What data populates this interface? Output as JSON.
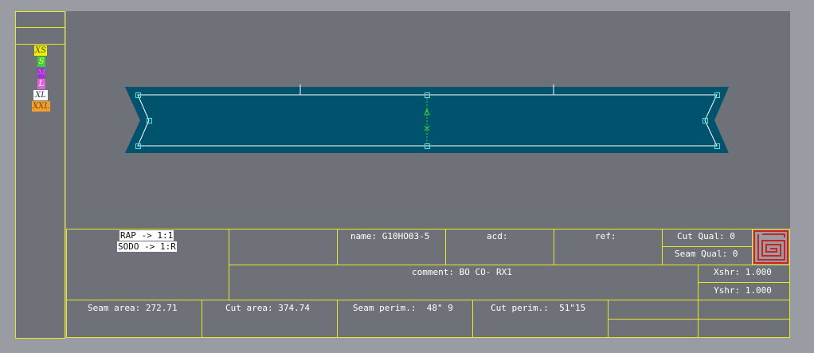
{
  "sizes": [
    {
      "label": "XS",
      "color": "#f0f000",
      "text": "#444444"
    },
    {
      "label": "S",
      "color": "#3dd23d",
      "text": "#ffff44"
    },
    {
      "label": "M",
      "color": "#a030d0",
      "text": "#c070f0"
    },
    {
      "label": "L",
      "color": "#e060e0",
      "text": "#ffffff"
    },
    {
      "label": "XL",
      "color": "#ffffff",
      "text": "#333333"
    },
    {
      "label": "XXL",
      "color": "#f0a030",
      "text": "#804000"
    }
  ],
  "info": {
    "rap": "RAP -> 1:1",
    "sodo": "SODO -> 1:R",
    "name": "name: G10HO03-5",
    "acd": "acd:",
    "ref": "ref:",
    "cut_qual": "Cut Qual: 0",
    "seam_qual": "Seam Qual: 0",
    "comment": "comment: BO CO- RX1",
    "xshr": "Xshr: 1.000",
    "yshr": "Yshr: 1.000",
    "seam_area": "Seam area: 272.71",
    "cut_area": "Cut area: 374.74",
    "seam_perim": "Seam perim.:  48\" 9",
    "cut_perim": "Cut perim.:  51\"15"
  },
  "colors": {
    "workspace": "#6f7178",
    "outer": "#9a9ca3",
    "piece_fill": "#00526d",
    "border": "#e8e82a",
    "logo": "#cc2222"
  }
}
